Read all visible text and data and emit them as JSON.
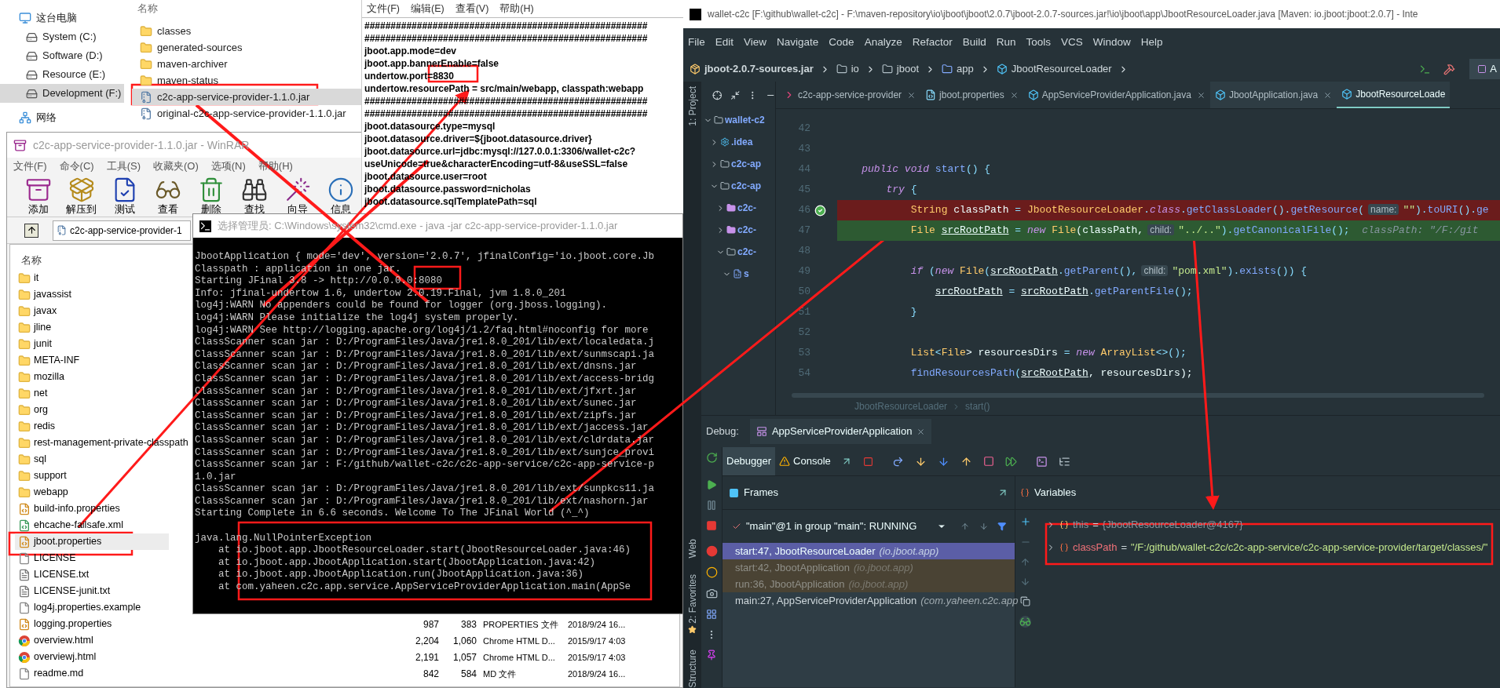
{
  "explorer": {
    "nav": [
      {
        "label": "这台电脑",
        "kind": "pc",
        "selected": false
      },
      {
        "label": "System (C:)",
        "kind": "drive",
        "selected": false
      },
      {
        "label": "Software (D:)",
        "kind": "drive",
        "selected": false
      },
      {
        "label": "Resource (E:)",
        "kind": "drive",
        "selected": false
      },
      {
        "label": "Development (F:)",
        "kind": "drive",
        "selected": true
      },
      {
        "label": "网络",
        "kind": "network",
        "selected": false
      }
    ],
    "column_header": "名称",
    "files": [
      {
        "name": "classes",
        "kind": "folder",
        "selected": false
      },
      {
        "name": "generated-sources",
        "kind": "folder",
        "selected": false
      },
      {
        "name": "maven-archiver",
        "kind": "folder",
        "selected": false
      },
      {
        "name": "maven-status",
        "kind": "folder",
        "selected": false
      },
      {
        "name": "c2c-app-service-provider-1.1.0.jar",
        "kind": "jar",
        "selected": true
      },
      {
        "name": "original-c2c-app-service-provider-1.1.0.jar",
        "kind": "jar",
        "selected": false
      }
    ]
  },
  "notepad": {
    "menu": [
      "文件(F)",
      "编辑(E)",
      "查看(V)",
      "帮助(H)"
    ],
    "lines": [
      "######################################################",
      "######################################################",
      "jboot.app.mode=dev",
      "jboot.app.bannerEnable=false",
      "undertow.port=8830",
      "undertow.resourcePath = src/main/webapp, classpath:webapp",
      "######################################################",
      "######################################################",
      "jboot.datasource.type=mysql",
      "jboot.datasource.driver=${jboot.datasource.driver}",
      "jboot.datasource.url=jdbc:mysql://127.0.0.1:3306/wallet-c2c?",
      "useUnicode=true&characterEncoding=utf-8&useSSL=false",
      "jboot.datasource.user=root",
      "jboot.datasource.password=nicholas",
      "jboot.datasource.sqlTemplatePath=sql"
    ]
  },
  "winrar": {
    "title": "c2c-app-service-provider-1.1.0.jar - WinRAR",
    "menu": [
      "文件(F)",
      "命令(C)",
      "工具(S)",
      "收藏夹(O)",
      "选项(N)",
      "帮助(H)"
    ],
    "toolbar": [
      {
        "label": "添加",
        "kind": "add"
      },
      {
        "label": "解压到",
        "kind": "extract"
      },
      {
        "label": "测试",
        "kind": "test"
      },
      {
        "label": "查看",
        "kind": "view"
      },
      {
        "label": "删除",
        "kind": "delete"
      },
      {
        "label": "查找",
        "kind": "find"
      },
      {
        "label": "向导",
        "kind": "wizard"
      },
      {
        "label": "信息",
        "kind": "info"
      }
    ],
    "path": "c2c-app-service-provider-1",
    "column_header": "名称",
    "files": [
      {
        "name": "it",
        "kind": "folder",
        "selected": false
      },
      {
        "name": "javassist",
        "kind": "folder",
        "selected": false
      },
      {
        "name": "javax",
        "kind": "folder",
        "selected": false
      },
      {
        "name": "jline",
        "kind": "folder",
        "selected": false
      },
      {
        "name": "junit",
        "kind": "folder",
        "selected": false
      },
      {
        "name": "META-INF",
        "kind": "folder",
        "selected": false
      },
      {
        "name": "mozilla",
        "kind": "folder",
        "selected": false
      },
      {
        "name": "net",
        "kind": "folder",
        "selected": false
      },
      {
        "name": "org",
        "kind": "folder",
        "selected": false
      },
      {
        "name": "redis",
        "kind": "folder",
        "selected": false
      },
      {
        "name": "rest-management-private-classpath",
        "kind": "folder",
        "selected": false
      },
      {
        "name": "sql",
        "kind": "folder",
        "selected": false
      },
      {
        "name": "support",
        "kind": "folder",
        "selected": false
      },
      {
        "name": "webapp",
        "kind": "folder",
        "selected": false
      },
      {
        "name": "build-info.properties",
        "kind": "properties",
        "selected": false
      },
      {
        "name": "ehcache-failsafe.xml",
        "kind": "xml",
        "selected": false
      },
      {
        "name": "jboot.properties",
        "kind": "properties",
        "selected": true
      },
      {
        "name": "LICENSE",
        "kind": "blank",
        "selected": false
      },
      {
        "name": "LICENSE.txt",
        "kind": "text",
        "selected": false
      },
      {
        "name": "LICENSE-junit.txt",
        "kind": "text",
        "selected": false
      },
      {
        "name": "log4j.properties.example",
        "kind": "blank",
        "selected": false
      },
      {
        "name": "logging.properties",
        "kind": "properties",
        "selected": false,
        "size": "987",
        "packed": "383",
        "type": "PROPERTIES 文件",
        "modified": "2018/9/24 16..."
      },
      {
        "name": "overview.html",
        "kind": "chrome",
        "selected": false,
        "size": "2,204",
        "packed": "1,060",
        "type": "Chrome HTML D...",
        "modified": "2015/9/17 4:03"
      },
      {
        "name": "overviewj.html",
        "kind": "chrome",
        "selected": false,
        "size": "2,191",
        "packed": "1,057",
        "type": "Chrome HTML D...",
        "modified": "2015/9/17 4:03"
      },
      {
        "name": "readme.md",
        "kind": "blank",
        "selected": false,
        "size": "842",
        "packed": "584",
        "type": "MD 文件",
        "modified": "2018/9/24 16..."
      }
    ]
  },
  "console": {
    "title": "选择管理员: C:\\Windows\\system32\\cmd.exe - java  -jar c2c-app-service-provider-1.1.0.jar",
    "lines": [
      "JbootApplication { mode='dev', version='2.0.7', jfinalConfig='io.jboot.core.Jb",
      "Classpath : application in one jar.",
      "Starting JFinal 3.8 -> http://0.0.0.0:8080",
      "Info: jfinal-undertow 1.6, undertow 2.0.19.Final, jvm 1.8.0_201",
      "log4j:WARN No appenders could be found for logger (org.jboss.logging).",
      "log4j:WARN Please initialize the log4j system properly.",
      "log4j:WARN See http://logging.apache.org/log4j/1.2/faq.html#noconfig for more",
      "ClassScanner scan jar : D:/ProgramFiles/Java/jre1.8.0_201/lib/ext/localedata.j",
      "ClassScanner scan jar : D:/ProgramFiles/Java/jre1.8.0_201/lib/ext/sunmscapi.ja",
      "ClassScanner scan jar : D:/ProgramFiles/Java/jre1.8.0_201/lib/ext/dnsns.jar",
      "ClassScanner scan jar : D:/ProgramFiles/Java/jre1.8.0_201/lib/ext/access-bridg",
      "ClassScanner scan jar : D:/ProgramFiles/Java/jre1.8.0_201/lib/ext/jfxrt.jar",
      "ClassScanner scan jar : D:/ProgramFiles/Java/jre1.8.0_201/lib/ext/sunec.jar",
      "ClassScanner scan jar : D:/ProgramFiles/Java/jre1.8.0_201/lib/ext/zipfs.jar",
      "ClassScanner scan jar : D:/ProgramFiles/Java/jre1.8.0_201/lib/ext/jaccess.jar",
      "ClassScanner scan jar : D:/ProgramFiles/Java/jre1.8.0_201/lib/ext/cldrdata.jar",
      "ClassScanner scan jar : D:/ProgramFiles/Java/jre1.8.0_201/lib/ext/sunjce_provi",
      "ClassScanner scan jar : F:/github/wallet-c2c/c2c-app-service/c2c-app-service-p",
      "1.0.jar",
      "ClassScanner scan jar : D:/ProgramFiles/Java/jre1.8.0_201/lib/ext/sunpkcs11.ja",
      "ClassScanner scan jar : D:/ProgramFiles/Java/jre1.8.0_201/lib/ext/nashorn.jar",
      "Starting Complete in 6.6 seconds. Welcome To The JFinal World (^_^)",
      "java.lang.NullPointerException",
      "\tat io.jboot.app.JbootResourceLoader.start(JbootResourceLoader.java:46)",
      "\tat io.jboot.app.JbootApplication.start(JbootApplication.java:42)",
      "\tat io.jboot.app.JbootApplication.run(JbootApplication.java:36)",
      "\tat com.yaheen.c2c.app.service.AppServiceProviderApplication.main(AppSe"
    ]
  },
  "ide": {
    "title": "wallet-c2c [F:\\github\\wallet-c2c] - F:\\maven-repository\\io\\jboot\\jboot\\2.0.7\\jboot-2.0.7-sources.jar!\\io\\jboot\\app\\JbootResourceLoader.java [Maven: io.jboot:jboot:2.0.7] - Inte",
    "menu": [
      "File",
      "Edit",
      "View",
      "Navigate",
      "Code",
      "Analyze",
      "Refactor",
      "Build",
      "Run",
      "Tools",
      "VCS",
      "Window",
      "Help"
    ],
    "breadcrumb": [
      {
        "label": "jboot-2.0.7-sources.jar",
        "kind": "jar"
      },
      {
        "label": "io",
        "kind": "folder"
      },
      {
        "label": "jboot",
        "kind": "folder"
      },
      {
        "label": "app",
        "kind": "package"
      },
      {
        "label": "JbootResourceLoader",
        "kind": "class"
      }
    ],
    "run_config": "A",
    "side_labels": {
      "top": "1: Project",
      "web": "Web",
      "favorites": "2: Favorites",
      "structure": "Structure"
    },
    "project_tree": [
      {
        "label": "wallet-c2",
        "kind": "folder",
        "expanded": true,
        "children": [
          {
            "label": ".idea",
            "kind": "settings",
            "expanded": false
          },
          {
            "label": "c2c-ap",
            "kind": "folder",
            "expanded": false
          },
          {
            "label": "c2c-ap",
            "kind": "folder",
            "expanded": true,
            "children": [
              {
                "label": "c2c-",
                "kind": "module",
                "expanded": false
              },
              {
                "label": "c2c-",
                "kind": "module",
                "expanded": false
              },
              {
                "label": "c2c-",
                "kind": "folder",
                "expanded": true,
                "children": [
                  {
                    "label": "s",
                    "kind": "source",
                    "expanded": true
                  }
                ]
              }
            ]
          }
        ]
      }
    ],
    "tabs": [
      {
        "label": "c2c-app-service-provider",
        "kind": "module",
        "selected": false
      },
      {
        "label": "jboot.properties",
        "kind": "properties",
        "selected": false
      },
      {
        "label": "AppServiceProviderApplication.java",
        "kind": "class",
        "selected": false
      },
      {
        "label": "JbootApplication.java",
        "kind": "class",
        "selected": false
      },
      {
        "label": "JbootResourceLoade",
        "kind": "class",
        "selected": true
      }
    ],
    "code": [
      {
        "number": "42",
        "kind": "normal"
      },
      {
        "number": "43",
        "kind": "normal"
      },
      {
        "number": "44",
        "kind": "normal",
        "tokens": [
          {
            "text": "    public void",
            "kind": "kw"
          },
          {
            "text": " start",
            "kind": "method"
          },
          {
            "text": "() {",
            "kind": "op"
          }
        ]
      },
      {
        "number": "45",
        "kind": "normal",
        "tokens": [
          {
            "text": "        try",
            "kind": "kw"
          },
          {
            "text": " {",
            "kind": "op"
          }
        ]
      },
      {
        "number": "46",
        "kind": "breakpoint",
        "tokens": [
          {
            "text": "            String",
            "kind": "type"
          },
          {
            "text": " classPath ",
            "kind": "ident"
          },
          {
            "text": "=",
            "kind": "op"
          },
          {
            "text": " JbootResourceLoader",
            "kind": "type"
          },
          {
            "text": ".",
            "kind": "op"
          },
          {
            "text": "class",
            "kind": "kw"
          },
          {
            "text": ".",
            "kind": "op"
          },
          {
            "text": "getClassLoader",
            "kind": "method"
          },
          {
            "text": "().",
            "kind": "op"
          },
          {
            "text": "getResource",
            "kind": "method"
          },
          {
            "text": "(",
            "kind": "op"
          },
          {
            "text": "name:",
            "kind": "hint"
          },
          {
            "text": "\"\"",
            "kind": "str"
          },
          {
            "text": ").",
            "kind": "op"
          },
          {
            "text": "toURI",
            "kind": "method"
          },
          {
            "text": "().",
            "kind": "op"
          },
          {
            "text": "ge",
            "kind": "method"
          }
        ]
      },
      {
        "number": "47",
        "kind": "current",
        "tokens": [
          {
            "text": "            File",
            "kind": "type"
          },
          {
            "text": " srcRootPath",
            "kind": "uvar"
          },
          {
            "text": " = ",
            "kind": "op"
          },
          {
            "text": "new",
            "kind": "kw"
          },
          {
            "text": " File",
            "kind": "type"
          },
          {
            "text": "(classPath,",
            "kind": "ident"
          },
          {
            "text": "child:",
            "kind": "hint"
          },
          {
            "text": "\"../..\"",
            "kind": "str"
          },
          {
            "text": ").",
            "kind": "op"
          },
          {
            "text": "getCanonicalFile",
            "kind": "method"
          },
          {
            "text": "();",
            "kind": "op"
          },
          {
            "text": "  classPath: \"/F:/git",
            "kind": "inline"
          }
        ]
      },
      {
        "number": "48",
        "kind": "normal"
      },
      {
        "number": "49",
        "kind": "normal",
        "tokens": [
          {
            "text": "            if",
            "kind": "kw"
          },
          {
            "text": " (",
            "kind": "op"
          },
          {
            "text": "new",
            "kind": "kw"
          },
          {
            "text": " File",
            "kind": "type"
          },
          {
            "text": "(",
            "kind": "op"
          },
          {
            "text": "srcRootPath",
            "kind": "uvar"
          },
          {
            "text": ".",
            "kind": "op"
          },
          {
            "text": "getParent",
            "kind": "method"
          },
          {
            "text": "(),",
            "kind": "op"
          },
          {
            "text": "child:",
            "kind": "hint"
          },
          {
            "text": "\"pom.xml\"",
            "kind": "str"
          },
          {
            "text": ").",
            "kind": "op"
          },
          {
            "text": "exists",
            "kind": "method"
          },
          {
            "text": "()) {",
            "kind": "op"
          }
        ]
      },
      {
        "number": "50",
        "kind": "normal",
        "tokens": [
          {
            "text": "                srcRootPath",
            "kind": "uvar"
          },
          {
            "text": " = ",
            "kind": "op"
          },
          {
            "text": "srcRootPath",
            "kind": "uvar"
          },
          {
            "text": ".",
            "kind": "op"
          },
          {
            "text": "getParentFile",
            "kind": "method"
          },
          {
            "text": "();",
            "kind": "op"
          }
        ]
      },
      {
        "number": "51",
        "kind": "normal",
        "tokens": [
          {
            "text": "            }",
            "kind": "op"
          }
        ]
      },
      {
        "number": "52",
        "kind": "normal"
      },
      {
        "number": "53",
        "kind": "normal",
        "tokens": [
          {
            "text": "            List",
            "kind": "type"
          },
          {
            "text": "<",
            "kind": "op"
          },
          {
            "text": "File",
            "kind": "type"
          },
          {
            "text": "> resourcesDirs ",
            "kind": "ident"
          },
          {
            "text": "=",
            "kind": "op"
          },
          {
            "text": " new",
            "kind": "kw"
          },
          {
            "text": " ArrayList",
            "kind": "type"
          },
          {
            "text": "<>();",
            "kind": "op"
          }
        ]
      },
      {
        "number": "54",
        "kind": "normal",
        "tokens": [
          {
            "text": "            findResourcesPath",
            "kind": "method"
          },
          {
            "text": "(",
            "kind": "op"
          },
          {
            "text": "srcRootPath",
            "kind": "uvar"
          },
          {
            "text": ", resourcesDirs);",
            "kind": "ident"
          }
        ]
      }
    ],
    "editor_breadcrumb": [
      "JbootResourceLoader",
      "start()"
    ],
    "debug": {
      "label": "Debug:",
      "session": "AppServiceProviderApplication",
      "tabs": [
        {
          "label": "Debugger",
          "kind": "debugger",
          "selected": true
        },
        {
          "label": "Console",
          "kind": "console",
          "selected": false
        }
      ],
      "frames_title": "Frames",
      "variables_title": "Variables",
      "thread": "\"main\"@1 in group \"main\": RUNNING",
      "frames": [
        {
          "method": "start:47, JbootResourceLoader",
          "package": "(io.jboot.app)",
          "selected": true,
          "library": true
        },
        {
          "method": "start:42, JbootApplication",
          "package": "(io.jboot.app)",
          "selected": false,
          "library": true
        },
        {
          "method": "run:36, JbootApplication",
          "package": "(io.jboot.app)",
          "selected": false,
          "library": true
        },
        {
          "method": "main:27, AppServiceProviderApplication",
          "package": "(com.yaheen.c2c.app",
          "selected": false,
          "library": false
        }
      ],
      "variables": [
        {
          "name": "this",
          "sep": "=",
          "value": "{JbootResourceLoader@4167}",
          "kind": "object"
        },
        {
          "name": "classPath",
          "sep": "=",
          "value": "\"/F:/github/wallet-c2c/c2c-app-service/c2c-app-service-provider/target/classes/\"",
          "kind": "string"
        }
      ]
    }
  }
}
